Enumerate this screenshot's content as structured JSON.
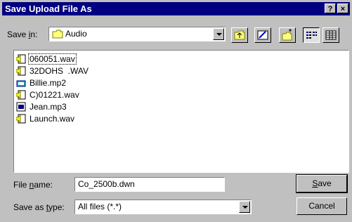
{
  "window": {
    "title": "Save Upload File As",
    "help_button": "?",
    "close_button": "×"
  },
  "save_in": {
    "label_pre": "Save ",
    "label_key": "i",
    "label_post": "n:",
    "value": "Audio"
  },
  "files": [
    {
      "name": "060051.wav",
      "icon": "audio-wav-icon",
      "selected": true
    },
    {
      "name": "32DOHS  .WAV",
      "icon": "audio-wav-icon",
      "selected": false
    },
    {
      "name": "Billie.mp2",
      "icon": "audio-mp2-icon",
      "selected": false
    },
    {
      "name": "C)01221.wav",
      "icon": "audio-wav-icon",
      "selected": false
    },
    {
      "name": "Jean.mp3",
      "icon": "audio-mp3-icon",
      "selected": false
    },
    {
      "name": "Launch.wav",
      "icon": "audio-wav-icon",
      "selected": false
    }
  ],
  "file_name": {
    "label_pre": "File ",
    "label_key": "n",
    "label_post": "ame:",
    "value": "Co_2500b.dwn"
  },
  "save_as_type": {
    "label_pre": "Save as ",
    "label_key": "t",
    "label_post": "ype:",
    "value": "All files (*.*)"
  },
  "buttons": {
    "save_key": "S",
    "save_rest": "ave",
    "cancel": "Cancel"
  }
}
